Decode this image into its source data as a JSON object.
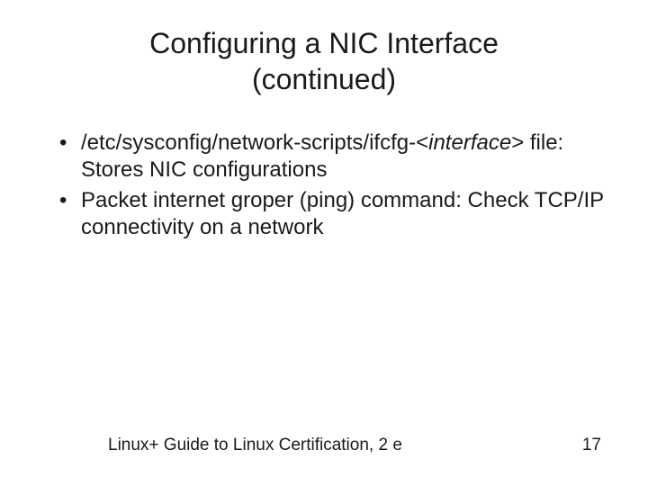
{
  "title_line1": "Configuring a NIC Interface",
  "title_line2": "(continued)",
  "bullets": [
    {
      "pre": "/etc/sysconfig/network-scripts/ifcfg-",
      "em_open": "<",
      "em_text": "interface",
      "em_close": ">",
      "post": " file: Stores NIC configurations"
    },
    {
      "text": "Packet internet groper (ping) command: Check TCP/IP connectivity on a network"
    }
  ],
  "footer": {
    "left": "Linux+ Guide to Linux Certification, 2 e",
    "right": "17"
  }
}
